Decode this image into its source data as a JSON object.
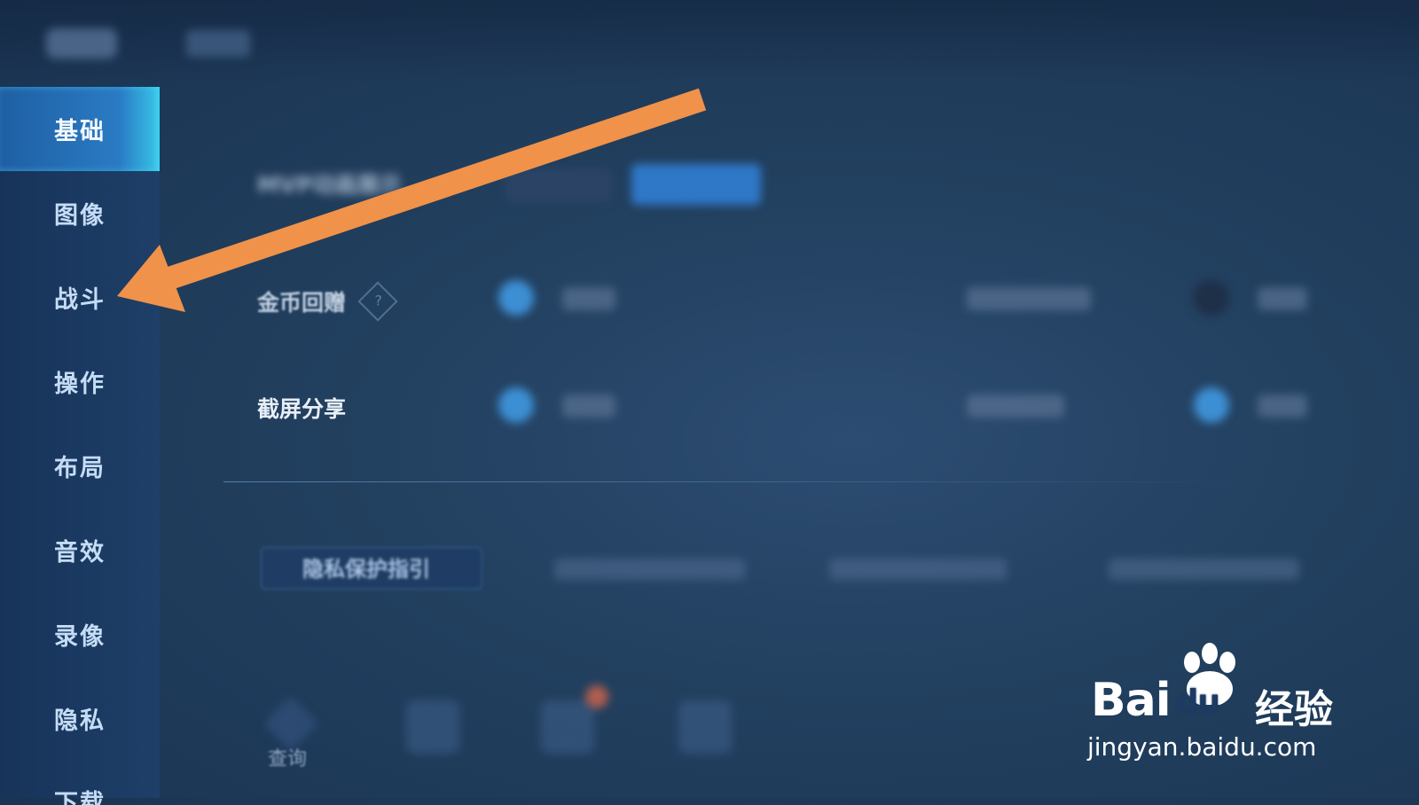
{
  "sidebar": {
    "items": [
      {
        "label": "基础",
        "active": true
      },
      {
        "label": "图像",
        "active": false
      },
      {
        "label": "战斗",
        "active": false
      },
      {
        "label": "操作",
        "active": false
      },
      {
        "label": "布局",
        "active": false
      },
      {
        "label": "音效",
        "active": false
      },
      {
        "label": "录像",
        "active": false
      },
      {
        "label": "隐私",
        "active": false
      },
      {
        "label": "下载",
        "active": false
      }
    ]
  },
  "settings": {
    "mvp_label": "MVP动画展示",
    "coin_label": "金币回赠",
    "help_glyph": "?",
    "screenshot_label": "截屏分享"
  },
  "privacy": {
    "guide_button": "隐私保护指引"
  },
  "dock": {
    "query_label": "查询"
  },
  "watermark": {
    "brand_latin": "Bai",
    "brand_du": "du",
    "brand_cn": "经验",
    "url": "jingyan.baidu.com"
  },
  "colors": {
    "accent": "#f0924a",
    "active_tab": "#2a7bc4",
    "background": "#22405f"
  }
}
